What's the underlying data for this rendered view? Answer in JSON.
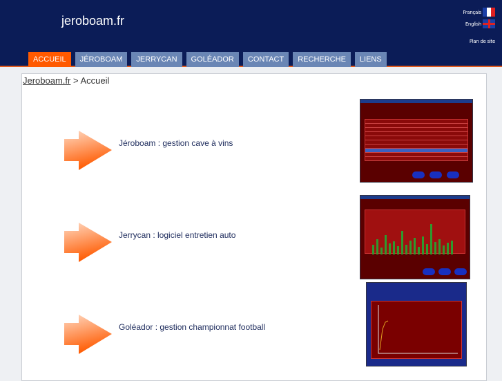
{
  "header": {
    "title": "jeroboam.fr",
    "lang_fr": "Français",
    "lang_en": "English",
    "sitemap": "Plan de site"
  },
  "nav": [
    {
      "label": "ACCUEIL",
      "active": true
    },
    {
      "label": "JÉROBOAM"
    },
    {
      "label": "JERRYCAN"
    },
    {
      "label": "GOLÉADOR"
    },
    {
      "label": "CONTACT"
    },
    {
      "label": "RECHERCHE"
    },
    {
      "label": "LIENS"
    }
  ],
  "breadcrumb": {
    "home": "Jeroboam.fr",
    "sep": " > ",
    "current": "Accueil"
  },
  "items": [
    {
      "label": "Jéroboam : gestion cave à vins"
    },
    {
      "label": "Jerrycan : logiciel entretien auto"
    },
    {
      "label": "Goléador : gestion championnat football"
    }
  ],
  "colors": {
    "header": "#0b1c57",
    "tab": "#6a86b5",
    "active_tab": "#ff5a00",
    "arrow": "#ff6a1a"
  }
}
